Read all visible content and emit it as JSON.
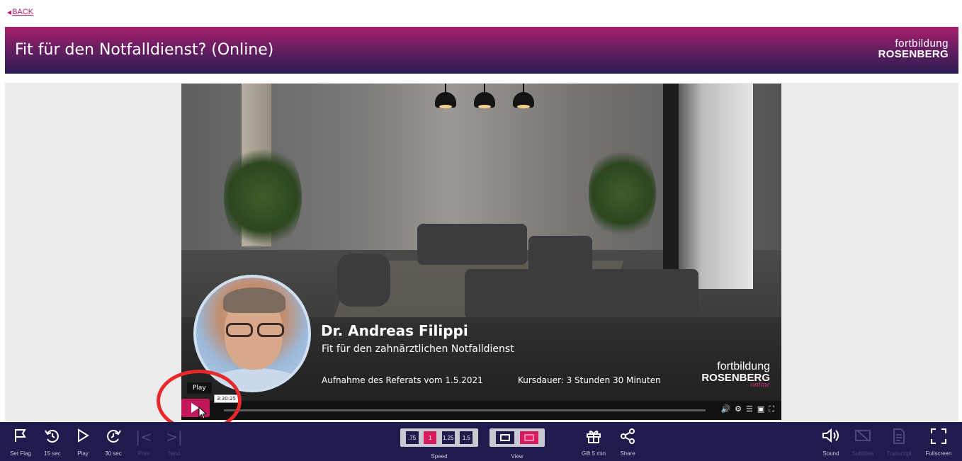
{
  "nav": {
    "back_label": "BACK"
  },
  "header": {
    "title": "Fit für den Notfalldienst? (Online)",
    "brand_line1": "fortbildung",
    "brand_line2": "ROSENBERG"
  },
  "video": {
    "speaker_name": "Dr. Andreas Filippi",
    "speaker_subtitle": "Fit für den zahnärztlichen Notfalldienst",
    "recording_date": "Aufnahme des Referats vom 1.5.2021",
    "duration": "Kursdauer:  3 Stunden 30 Minuten",
    "brand_line1": "fortbildung",
    "brand_line2": "ROSENBERG",
    "brand_line3": "online",
    "tooltip": "Play",
    "timecode": "3:30:25"
  },
  "toolbar": {
    "set_flag": "Set Flag",
    "back15": "15 sec",
    "play": "Play",
    "fwd30": "30 sec",
    "prev": "Prev",
    "next": "Next",
    "speed_label": "Speed",
    "speeds": [
      ".75",
      "1",
      "1.25",
      "1.5"
    ],
    "active_speed": "1",
    "view_label": "View",
    "gift": "Gift 5 min",
    "share": "Share",
    "sound": "Sound",
    "subtitles": "Subtitles",
    "transcript": "Transcript",
    "fullscreen": "Fullscreen"
  },
  "colors": {
    "accent": "#d81b60",
    "toolbar_bg": "#1e1b4d",
    "highlight_circle": "#e8282a"
  }
}
